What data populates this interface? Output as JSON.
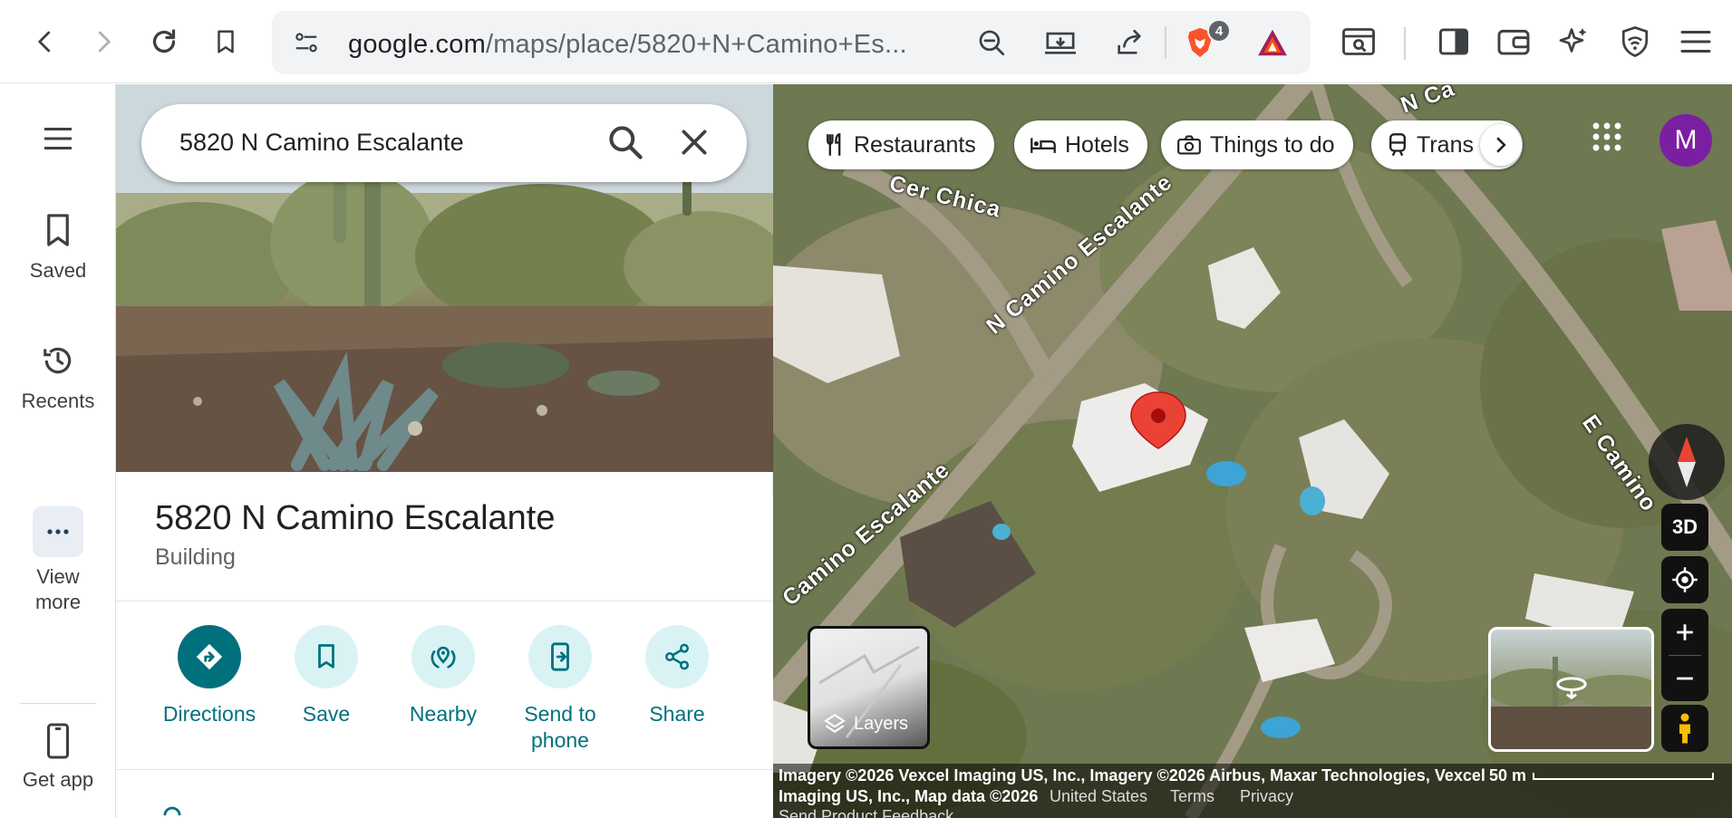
{
  "browser": {
    "url_host": "google.com",
    "url_path": "/maps/place/5820+N+Camino+Es...",
    "brave_badge_count": "4",
    "icons": [
      "back-icon",
      "forward-icon",
      "reload-icon",
      "bookmark-icon",
      "site-settings-icon",
      "zoom-out-icon",
      "install-app-icon",
      "share-icon",
      "brave-shields-icon",
      "brave-rewards-icon",
      "screenshot-icon",
      "sidebar-icon",
      "wallet-icon",
      "leo-ai-icon",
      "vpn-icon",
      "menu-icon"
    ]
  },
  "rail": {
    "saved": "Saved",
    "recents": "Recents",
    "view_more_1": "View",
    "view_more_2": "more",
    "get_app": "Get app"
  },
  "search": {
    "value": "5820 N Camino Escalante"
  },
  "place": {
    "title": "5820 N Camino Escalante",
    "type": "Building"
  },
  "actions": {
    "directions": "Directions",
    "save": "Save",
    "nearby": "Nearby",
    "send_1": "Send to",
    "send_2": "phone",
    "share": "Share"
  },
  "map": {
    "chips": {
      "restaurants": "Restaurants",
      "hotels": "Hotels",
      "things": "Things to do",
      "transit": "Trans"
    },
    "avatar_letter": "M",
    "streets": {
      "cer_chica": "Cer Chica",
      "n_camino": "N Camino Escalante",
      "camino_lower": "Camino Escalante",
      "e_camino": "E Camino",
      "n_ca": "N Ca"
    },
    "controls": {
      "three_d": "3D",
      "layers": "Layers"
    },
    "attribution": {
      "line1": "Imagery ©2026 Vexcel Imaging US, Inc., Imagery ©2026 Airbus, Maxar Technologies, Vexcel",
      "line2": "Imaging US, Inc., Map data ©2026",
      "country": "United States",
      "terms": "Terms",
      "privacy": "Privacy",
      "feedback": "Send Product Feedback",
      "scale": "50 m"
    }
  },
  "colors": {
    "teal_primary": "#00717c",
    "teal_light": "#d9f3f5",
    "pin_red": "#ea4335",
    "avatar_purple": "#7b1fa2"
  }
}
